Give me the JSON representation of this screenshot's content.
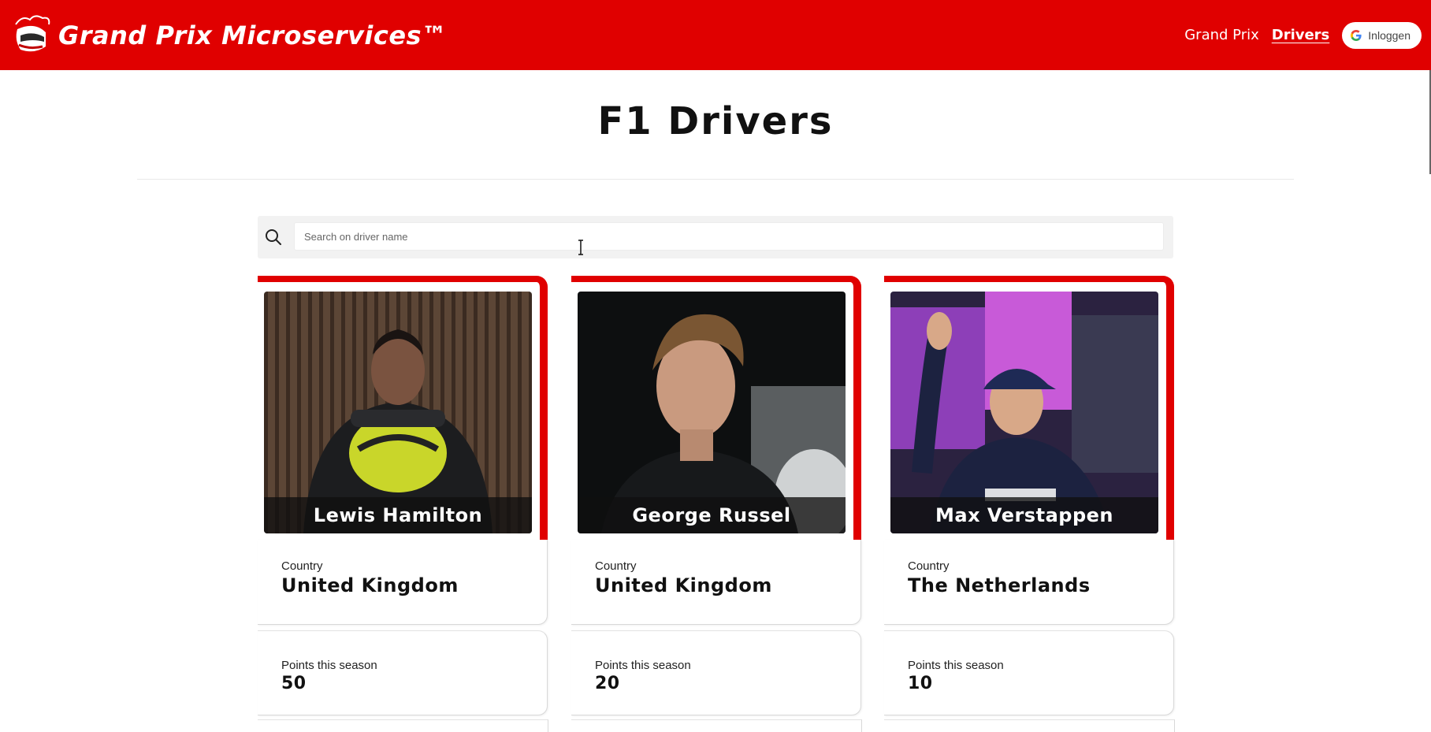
{
  "header": {
    "brand_title": "Grand Prix Microservices™",
    "nav": [
      {
        "label": "Grand Prix",
        "active": false
      },
      {
        "label": "Drivers",
        "active": true
      }
    ],
    "login_label": "Inloggen",
    "accent_color": "#e00000"
  },
  "page": {
    "title": "F1 Drivers"
  },
  "search": {
    "placeholder": "Search on driver name",
    "value": ""
  },
  "drivers": [
    {
      "name": "Lewis Hamilton",
      "country_label": "Country",
      "country": "United Kingdom",
      "points_label": "Points this season",
      "points": "50"
    },
    {
      "name": "George Russel",
      "country_label": "Country",
      "country": "United Kingdom",
      "points_label": "Points this season",
      "points": "20"
    },
    {
      "name": "Max Verstappen",
      "country_label": "Country",
      "country": "The Netherlands",
      "points_label": "Points this season",
      "points": "10"
    }
  ]
}
